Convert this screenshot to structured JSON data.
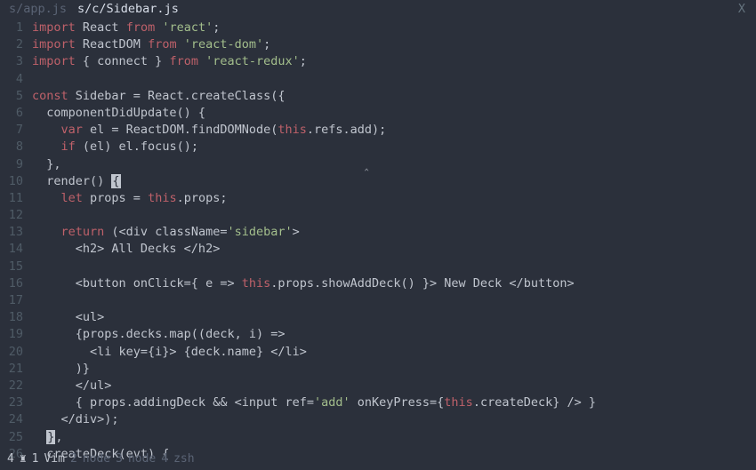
{
  "tabs": {
    "items": [
      {
        "label": "s/app.js",
        "active": false
      },
      {
        "label": "s/c/Sidebar.js",
        "active": true
      }
    ],
    "close_label": "X"
  },
  "code": {
    "lines": [
      {
        "n": 1,
        "segs": [
          [
            "kw",
            "import"
          ],
          [
            "pl",
            " React "
          ],
          [
            "kw",
            "from"
          ],
          [
            "pl",
            " "
          ],
          [
            "str",
            "'react'"
          ],
          [
            "pl",
            ";"
          ]
        ]
      },
      {
        "n": 2,
        "segs": [
          [
            "kw",
            "import"
          ],
          [
            "pl",
            " ReactDOM "
          ],
          [
            "kw",
            "from"
          ],
          [
            "pl",
            " "
          ],
          [
            "str",
            "'react-dom'"
          ],
          [
            "pl",
            ";"
          ]
        ]
      },
      {
        "n": 3,
        "segs": [
          [
            "kw",
            "import"
          ],
          [
            "pl",
            " { connect } "
          ],
          [
            "kw",
            "from"
          ],
          [
            "pl",
            " "
          ],
          [
            "str",
            "'react-redux'"
          ],
          [
            "pl",
            ";"
          ]
        ]
      },
      {
        "n": 4,
        "segs": []
      },
      {
        "n": 5,
        "segs": [
          [
            "kw",
            "const"
          ],
          [
            "pl",
            " Sidebar = React.createClass({"
          ]
        ]
      },
      {
        "n": 6,
        "segs": [
          [
            "pl",
            "  componentDidUpdate() {"
          ]
        ]
      },
      {
        "n": 7,
        "segs": [
          [
            "pl",
            "    "
          ],
          [
            "kw",
            "var"
          ],
          [
            "pl",
            " el = ReactDOM.findDOMNode("
          ],
          [
            "this",
            "this"
          ],
          [
            "pl",
            ".refs.add);"
          ]
        ]
      },
      {
        "n": 8,
        "segs": [
          [
            "pl",
            "    "
          ],
          [
            "kw",
            "if"
          ],
          [
            "pl",
            " (el) el.focus();"
          ]
        ]
      },
      {
        "n": 9,
        "segs": [
          [
            "pl",
            "  },                                          "
          ],
          [
            "txtcur",
            "‸"
          ]
        ]
      },
      {
        "n": 10,
        "segs": [
          [
            "pl",
            "  render() "
          ],
          [
            "cur",
            "{"
          ]
        ]
      },
      {
        "n": 11,
        "segs": [
          [
            "pl",
            "    "
          ],
          [
            "kw",
            "let"
          ],
          [
            "pl",
            " props = "
          ],
          [
            "this",
            "this"
          ],
          [
            "pl",
            ".props;"
          ]
        ]
      },
      {
        "n": 12,
        "segs": []
      },
      {
        "n": 13,
        "segs": [
          [
            "pl",
            "    "
          ],
          [
            "kw",
            "return"
          ],
          [
            "pl",
            " (<div className="
          ],
          [
            "str",
            "'sidebar'"
          ],
          [
            "pl",
            ">"
          ]
        ]
      },
      {
        "n": 14,
        "segs": [
          [
            "pl",
            "      <h2> All Decks </h2>"
          ]
        ]
      },
      {
        "n": 15,
        "segs": []
      },
      {
        "n": 16,
        "segs": [
          [
            "pl",
            "      <button onClick={ e => "
          ],
          [
            "this",
            "this"
          ],
          [
            "pl",
            ".props.showAddDeck() }> New Deck </button>"
          ]
        ]
      },
      {
        "n": 17,
        "segs": []
      },
      {
        "n": 18,
        "segs": [
          [
            "pl",
            "      <ul>"
          ]
        ]
      },
      {
        "n": 19,
        "segs": [
          [
            "pl",
            "      {props.decks.map((deck, i) =>"
          ]
        ]
      },
      {
        "n": 20,
        "segs": [
          [
            "pl",
            "        <li key={i}> {deck.name} </li>"
          ]
        ]
      },
      {
        "n": 21,
        "segs": [
          [
            "pl",
            "      )}"
          ]
        ]
      },
      {
        "n": 22,
        "segs": [
          [
            "pl",
            "      </ul>"
          ]
        ]
      },
      {
        "n": 23,
        "segs": [
          [
            "pl",
            "      { props.addingDeck && <input ref="
          ],
          [
            "str",
            "'add'"
          ],
          [
            "pl",
            " onKeyPress={"
          ],
          [
            "this",
            "this"
          ],
          [
            "pl",
            ".createDeck} /> }"
          ]
        ]
      },
      {
        "n": 24,
        "segs": [
          [
            "pl",
            "    </div>);"
          ]
        ]
      },
      {
        "n": 25,
        "segs": [
          [
            "pl",
            "  "
          ],
          [
            "cur",
            "}"
          ],
          [
            "pl",
            ","
          ]
        ]
      },
      {
        "n": 26,
        "segs": [
          [
            "pl",
            "  createDeck(evt) {"
          ]
        ]
      }
    ]
  },
  "statusbar": {
    "left_num": "4",
    "rook": "♜",
    "pane1_num": "1",
    "pane1_name": "Vim",
    "pane2_num": "2",
    "pane2_name": "node",
    "pane3_num": "3",
    "pane3_name": "node",
    "pane4_num": "4",
    "pane4_name": "zsh"
  }
}
